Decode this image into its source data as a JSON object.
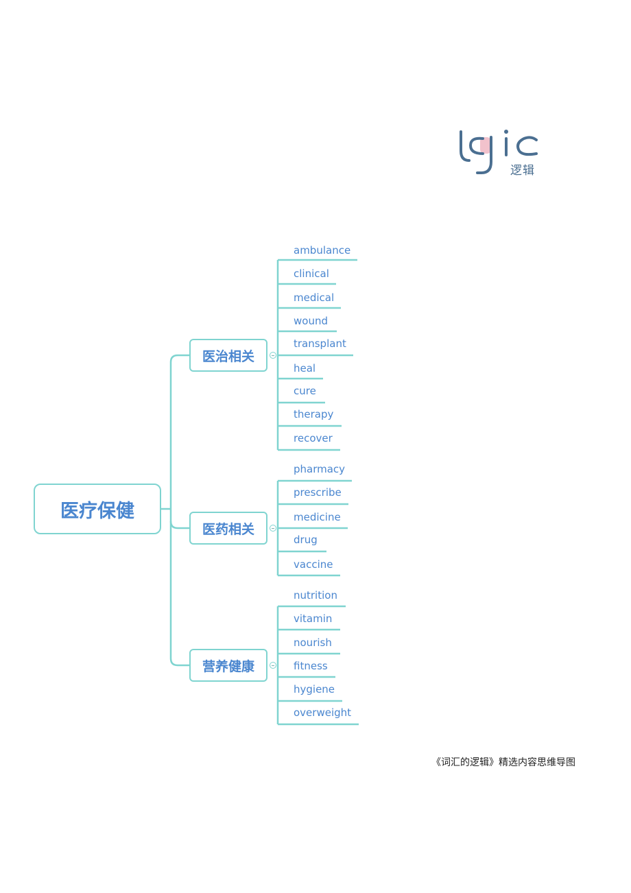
{
  "brand": {
    "logo_text": "logic",
    "logo_cn": "逻辑",
    "colors": {
      "logo_blue": "#4b6f91",
      "logo_pink": "#f2c2cc"
    }
  },
  "colors": {
    "line": "#7fd4d0",
    "text": "#4a86cf"
  },
  "mindmap": {
    "root": "医疗保健",
    "branches": [
      {
        "label": "医治相关",
        "leaves": [
          "ambulance",
          "clinical",
          "medical",
          "wound",
          "transplant",
          "heal",
          "cure",
          "therapy",
          "recover"
        ]
      },
      {
        "label": "医药相关",
        "leaves": [
          "pharmacy",
          "prescribe",
          "medicine",
          "drug",
          "vaccine"
        ]
      },
      {
        "label": "营养健康",
        "leaves": [
          "nutrition",
          "vitamin",
          "nourish",
          "fitness",
          "hygiene",
          "overweight"
        ]
      }
    ]
  },
  "caption": "《词汇的逻辑》精选内容思维导图"
}
